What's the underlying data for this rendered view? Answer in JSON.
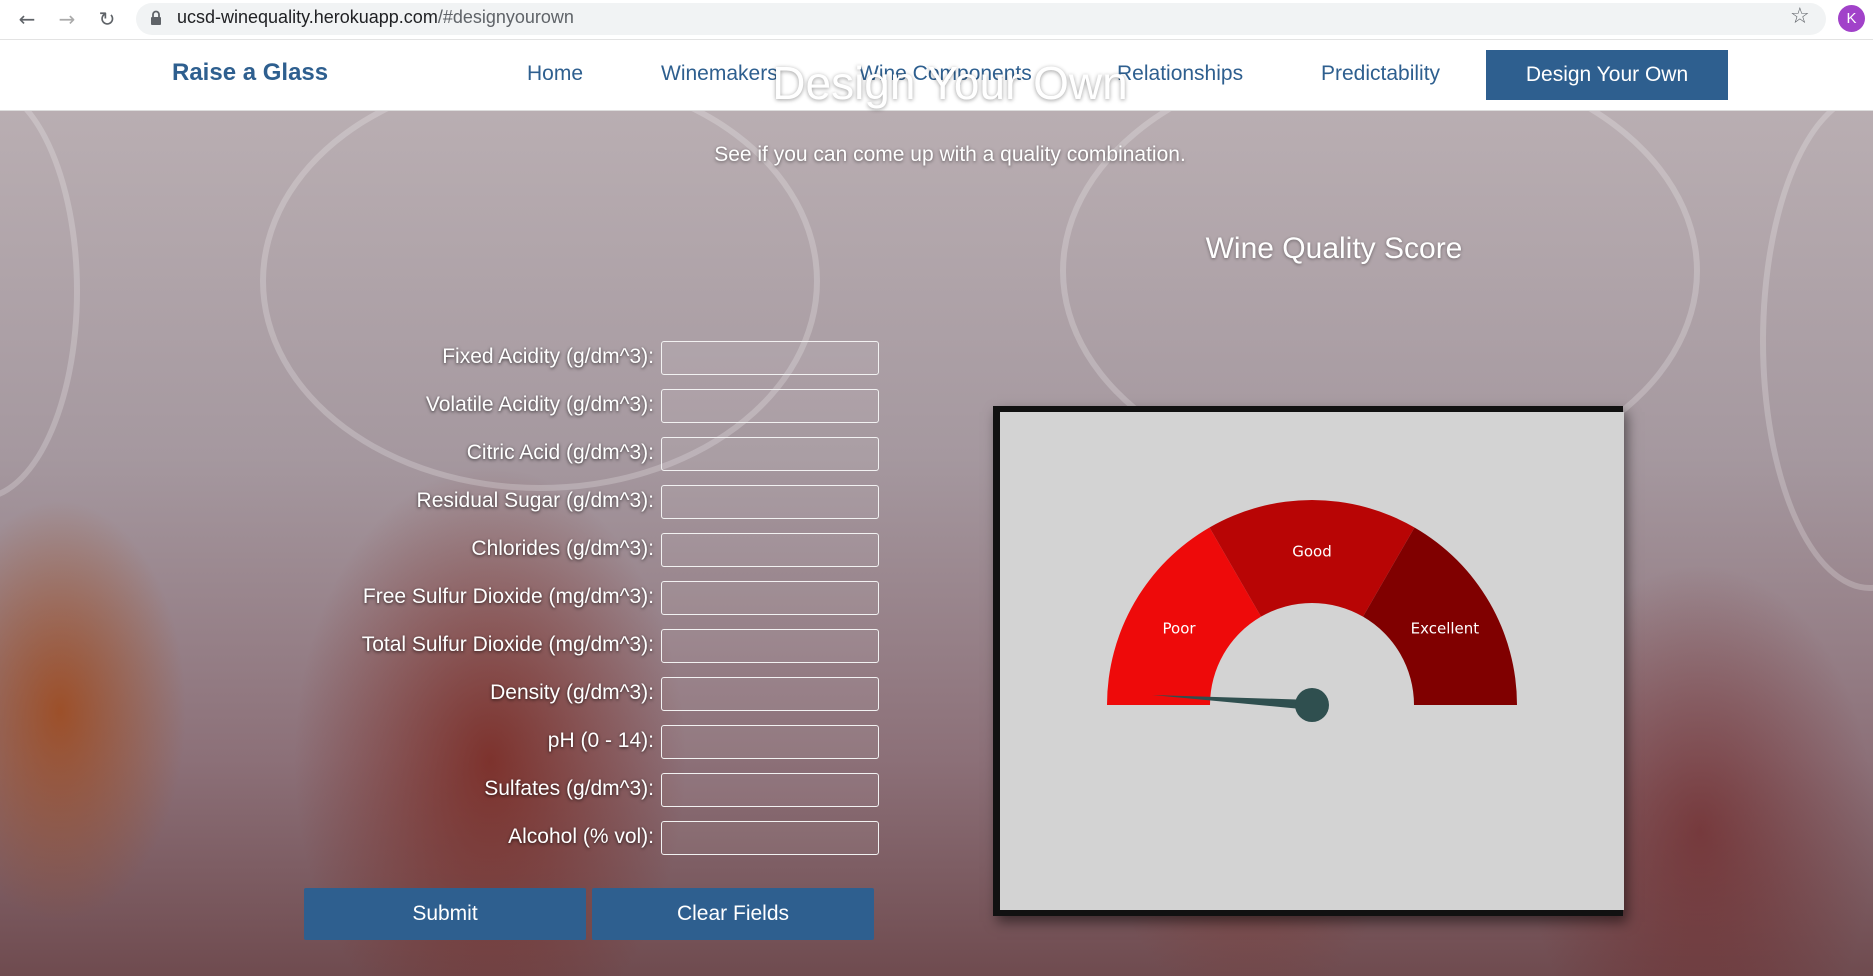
{
  "browser": {
    "url_host": "ucsd-winequality.herokuapp.com",
    "url_path": "/#designyourown",
    "avatar_letter": "K"
  },
  "nav": {
    "brand": "Raise a Glass",
    "links": [
      "Home",
      "Winemakers",
      "Wine Components",
      "Relationships",
      "Predictability"
    ],
    "active": "Design Your Own"
  },
  "hero": {
    "title": "Design Your Own",
    "subtitle": "See if you can come up with a quality combination."
  },
  "form": {
    "fields": [
      {
        "label": "Fixed Acidity (g/dm^3):",
        "value": ""
      },
      {
        "label": "Volatile Acidity (g/dm^3):",
        "value": ""
      },
      {
        "label": "Citric Acid (g/dm^3):",
        "value": ""
      },
      {
        "label": "Residual Sugar (g/dm^3):",
        "value": ""
      },
      {
        "label": "Chlorides (g/dm^3):",
        "value": ""
      },
      {
        "label": "Free Sulfur Dioxide (mg/dm^3):",
        "value": ""
      },
      {
        "label": "Total Sulfur Dioxide (mg/dm^3):",
        "value": ""
      },
      {
        "label": "Density (g/dm^3):",
        "value": ""
      },
      {
        "label": "pH (0 - 14):",
        "value": ""
      },
      {
        "label": "Sulfates (g/dm^3):",
        "value": ""
      },
      {
        "label": "Alcohol (% vol):",
        "value": ""
      }
    ],
    "submit_label": "Submit",
    "clear_label": "Clear Fields"
  },
  "gauge": {
    "title": "Wine Quality Score",
    "segments": [
      {
        "label": "Poor",
        "color": "#ee0a0a"
      },
      {
        "label": "Good",
        "color": "#b80505"
      },
      {
        "label": "Excellent",
        "color": "#800000"
      }
    ],
    "needle_value": 0.02,
    "needle_color": "#2f4f4f"
  },
  "colors": {
    "primary": "#2e5f8f"
  }
}
